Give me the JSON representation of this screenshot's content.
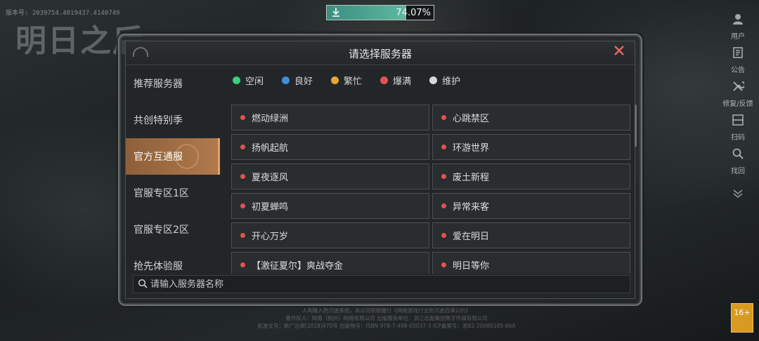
{
  "version": "版本号: 2039754.4019437.4140749",
  "logo_text": "明日之后",
  "download": {
    "progress_text": "74.07%",
    "progress": 0.7407,
    "icon": "download-arrow-icon"
  },
  "dialog": {
    "title": "请选择服务器",
    "close_icon": "close-icon"
  },
  "tabs": [
    {
      "label": "推荐服务器"
    },
    {
      "label": "共创特别季"
    },
    {
      "label": "官方互通服",
      "active": true
    },
    {
      "label": "官服专区1区"
    },
    {
      "label": "官服专区2区"
    },
    {
      "label": "抢先体验服"
    }
  ],
  "legend": [
    {
      "label": "空闲",
      "color": "#3ccf7a"
    },
    {
      "label": "良好",
      "color": "#3d8fd9"
    },
    {
      "label": "繁忙",
      "color": "#e9a534"
    },
    {
      "label": "爆满",
      "color": "#e2534f"
    },
    {
      "label": "维护",
      "color": "#d8d8d8"
    }
  ],
  "servers": [
    {
      "name": "燃动绿洲",
      "status_color": "#e2534f"
    },
    {
      "name": "心跳禁区",
      "status_color": "#e2534f"
    },
    {
      "name": "扬帆起航",
      "status_color": "#e2534f"
    },
    {
      "name": "环游世界",
      "status_color": "#e2534f"
    },
    {
      "name": "夏夜逐风",
      "status_color": "#e2534f"
    },
    {
      "name": "废土新程",
      "status_color": "#e2534f"
    },
    {
      "name": "初夏蝉鸣",
      "status_color": "#e2534f"
    },
    {
      "name": "异常来客",
      "status_color": "#e2534f"
    },
    {
      "name": "开心万岁",
      "status_color": "#e2534f"
    },
    {
      "name": "爱在明日",
      "status_color": "#e2534f"
    },
    {
      "name": "【激征夏尔】爽战夺金",
      "status_color": "#e2534f"
    },
    {
      "name": "明日等你",
      "status_color": "#e2534f"
    }
  ],
  "search": {
    "placeholder": "请输入服务器名称",
    "value": ""
  },
  "side_menu": [
    {
      "label": "用户",
      "icon": "user-icon"
    },
    {
      "label": "公告",
      "icon": "notice-icon"
    },
    {
      "label": "修复/反馈",
      "icon": "repair-icon"
    },
    {
      "label": "扫码",
      "icon": "qr-scan-icon"
    },
    {
      "label": "找回",
      "icon": "search-recover-icon"
    }
  ],
  "age_rating": "16+",
  "footer_lines": [
    "人到输入防沉迷系统，本公司积极履行《网络游戏行业防沉迷自律公约》",
    "著作权人：网易（杭州）网络有限公司    出版服务单位：浙江出版集团数字传媒有限公司",
    "批准文号：新广出审[2018]470号    出版物号：ISBN 978-7-498-05037-3    ICP备案号：浙B2-20080185-66A"
  ]
}
